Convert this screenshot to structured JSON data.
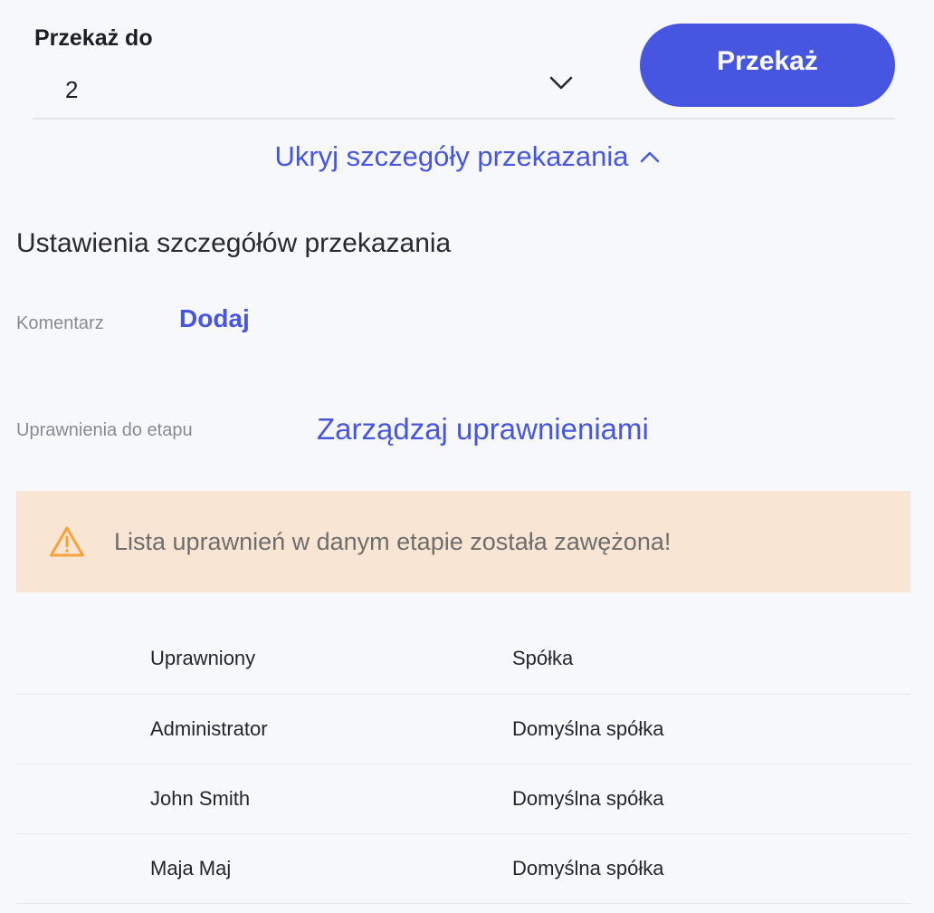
{
  "transfer": {
    "label": "Przekaż do",
    "selected_value": "2",
    "button_label": "Przekaż"
  },
  "details_toggle": {
    "label": "Ukryj szczegóły przekazania"
  },
  "settings": {
    "title": "Ustawienia szczegółów przekazania",
    "comment_label": "Komentarz",
    "comment_action": "Dodaj",
    "permissions_label": "Uprawnienia do etapu",
    "permissions_action": "Zarządzaj uprawnieniami"
  },
  "warning": {
    "text": "Lista uprawnień w danym etapie została zawężona!",
    "color": "#f5a33a"
  },
  "table": {
    "columns": [
      "Uprawniony",
      "Spółka"
    ],
    "rows": [
      {
        "user": "Administrator",
        "company": "Domyślna spółka"
      },
      {
        "user": "John Smith",
        "company": "Domyślna spółka"
      },
      {
        "user": "Maja Maj",
        "company": "Domyślna spółka"
      }
    ]
  },
  "colors": {
    "accent": "#4656e0",
    "warning_bg": "#f9e5d3",
    "background": "#f7f8fc"
  }
}
